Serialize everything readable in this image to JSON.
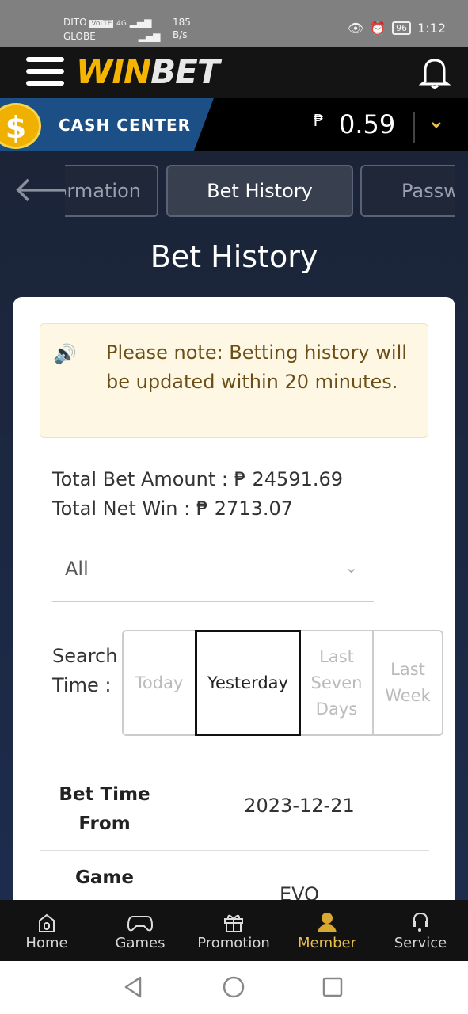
{
  "status": {
    "carrier1": "DITO",
    "carrier2": "GLOBE",
    "volte": "VoLTE",
    "net": "4G",
    "speed": "185",
    "speed_unit": "B/s",
    "battery": "96",
    "time": "1:12"
  },
  "header": {
    "logo_win": "WIN",
    "logo_bet": "BET"
  },
  "cash": {
    "label": "CASH CENTER",
    "currency": "₱",
    "balance": "0.59"
  },
  "tabs": [
    {
      "label": "Information"
    },
    {
      "label": "Bet History"
    },
    {
      "label": "Password"
    }
  ],
  "page_title": "Bet History",
  "notice": "Please note: Betting history will be updated within 20 minutes.",
  "totals": {
    "bet_label": "Total Bet Amount : ₱ 24591.69",
    "net_label": "Total Net Win : ₱ 2713.07"
  },
  "filter": {
    "selected": "All"
  },
  "search_time": {
    "label": "Search Time :",
    "options": [
      "Today",
      "Yesterday",
      "Last Seven Days",
      "Last Week"
    ],
    "selected": "Yesterday"
  },
  "table": [
    {
      "label": "Bet Time From",
      "value": "2023-12-21"
    },
    {
      "label": "Game",
      "value": "EVO"
    }
  ],
  "nav": [
    {
      "label": "Home",
      "icon": "home-icon"
    },
    {
      "label": "Games",
      "icon": "gamepad-icon"
    },
    {
      "label": "Promotion",
      "icon": "gift-icon"
    },
    {
      "label": "Member",
      "icon": "user-icon",
      "active": true
    },
    {
      "label": "Service",
      "icon": "headset-icon"
    }
  ],
  "colors": {
    "accent": "#f5b400",
    "active_nav": "#e8c04a",
    "cash_tab": "#1c4f86"
  }
}
